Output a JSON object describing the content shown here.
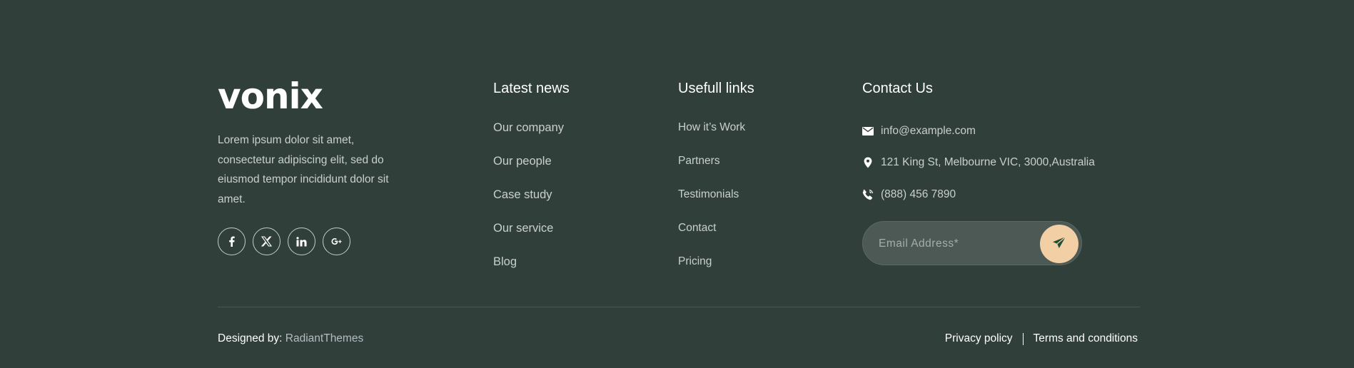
{
  "brand": {
    "logo_text": "vonix",
    "about": "Lorem ipsum dolor sit amet, consectetur adipiscing elit, sed do eiusmod tempor incididunt dolor sit amet."
  },
  "socials": [
    {
      "name": "facebook-icon",
      "glyph": "f"
    },
    {
      "name": "x-twitter-icon",
      "glyph": "𝕏"
    },
    {
      "name": "linkedin-icon",
      "glyph": "in"
    },
    {
      "name": "google-plus-icon",
      "glyph": "G+"
    }
  ],
  "latest_news": {
    "title": "Latest news",
    "items": [
      "Our company",
      "Our people",
      "Case study",
      "Our service",
      "Blog"
    ]
  },
  "useful_links": {
    "title": "Usefull links",
    "items": [
      "How it’s Work",
      "Partners",
      "Testimonials",
      "Contact",
      "Pricing"
    ]
  },
  "contact": {
    "title": "Contact Us",
    "email": "info@example.com",
    "address": "121 King St, Melbourne VIC, 3000,Australia",
    "phone": "(888) 456 7890"
  },
  "subscribe": {
    "placeholder": "Email Address*"
  },
  "bottom": {
    "designed_by_label": "Designed by:",
    "designer": "RadiantThemes",
    "privacy": "Privacy policy",
    "terms": "Terms and conditions"
  },
  "colors": {
    "background": "#313f3b",
    "accent": "#f2cfa4",
    "send_icon": "#1f4d36"
  }
}
